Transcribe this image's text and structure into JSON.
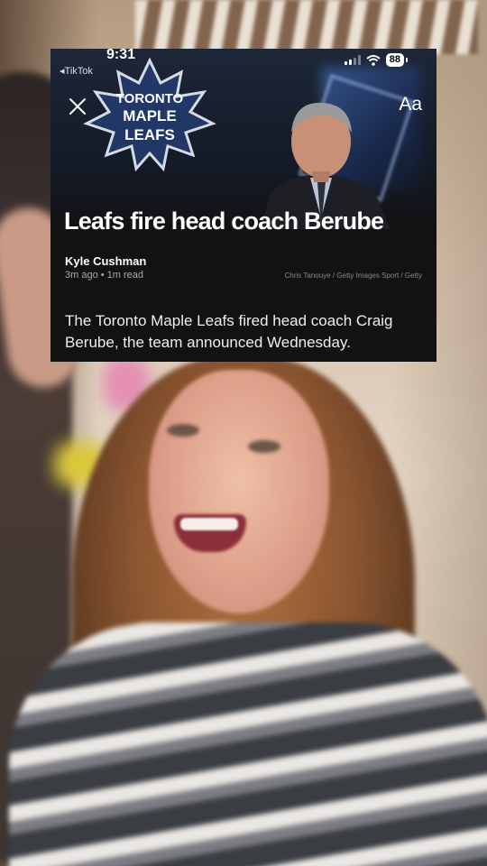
{
  "status_bar": {
    "time": "9:31",
    "back_app": "TikTok",
    "battery": "88"
  },
  "article": {
    "font_size_button": "Aa",
    "logo_text": [
      "TORONTO",
      "MAPLE",
      "LEAFS"
    ],
    "headline": "Leafs fire head coach Berube",
    "author": "Kyle Cushman",
    "meta": "3m ago • 1m read",
    "photo_credit": "Chris Tanouye / Getty Images Sport / Getty",
    "summary": "The Toronto Maple Leafs fired head coach Craig Berube, the team announced Wednesday."
  },
  "colors": {
    "card_bg": "#121212",
    "hero_bg": "#1d2738",
    "text_primary": "#ffffff",
    "text_secondary": "#aaaaaa"
  },
  "icons": {
    "close": "close-icon",
    "signal": "cellular-signal-icon",
    "wifi": "wifi-icon",
    "battery": "battery-icon",
    "back": "back-arrow-icon"
  }
}
